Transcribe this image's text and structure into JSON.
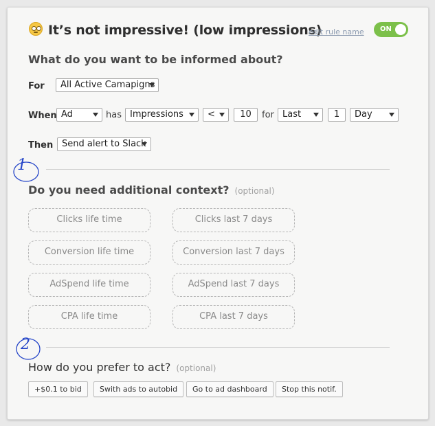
{
  "rule": {
    "title": "It’s not impressive! (low impressions)",
    "edit_link": "edit rule name",
    "toggle_label": "ON",
    "emoji": "face-with-rolling-eyes-icon"
  },
  "section_inform": {
    "heading": "What do you want to be informed about?",
    "for_label": "For",
    "for_value": "All Active Camapigns",
    "when_label": "When",
    "when_entity": "Ad",
    "has_text": "has",
    "metric": "Impressions",
    "operator": "<",
    "threshold": "10",
    "for_text": "for",
    "period_type": "Last",
    "period_count": "1",
    "period_unit": "Day",
    "then_label": "Then",
    "then_value": "Send alert to Slack"
  },
  "section_context": {
    "heading": "Do you need additional context?",
    "optional": "(optional)",
    "options": [
      "Clicks life time",
      "Clicks last 7 days",
      "Conversion life time",
      "Conversion last 7 days",
      "AdSpend life time",
      "AdSpend last 7 days",
      "CPA life time",
      "CPA last 7 days"
    ]
  },
  "section_act": {
    "heading": "How do you prefer to act?",
    "optional": "(optional)",
    "actions": [
      "+$0.1 to bid",
      "Swith ads to autobid",
      "Go to ad dashboard",
      "Stop this notif."
    ]
  },
  "annotations": {
    "one": "1",
    "two": "2"
  },
  "colors": {
    "toggle_on": "#7cc04a",
    "annotation": "#2545c8",
    "link": "#8c9bb0"
  }
}
